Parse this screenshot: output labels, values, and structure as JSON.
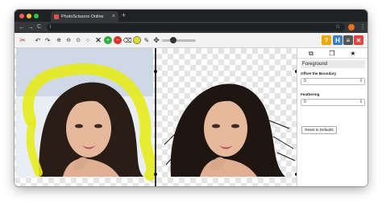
{
  "browser": {
    "tab_title": "PhotoScissors Online",
    "tab_close": "×",
    "new_tab": "+",
    "nav_back": "←",
    "nav_forward": "→",
    "nav_reload": "C",
    "info_icon": "i",
    "star": "☆",
    "menu": "⋮",
    "traffic_colors": [
      "#ff5f57",
      "#febc2e",
      "#28c840"
    ],
    "profile_color": "#e8711a"
  },
  "toolbar": {
    "icons": [
      "app-logo",
      "undo",
      "redo",
      "zoom-in",
      "zoom-out",
      "zoom-fit",
      "zoom-reset",
      "clear-marks",
      "foreground-marker",
      "background-marker",
      "eraser",
      "auto-contour",
      "eraser-alt",
      "pan"
    ],
    "right_buttons": [
      {
        "label": "?",
        "color": "#f0a500"
      },
      {
        "label": "H",
        "color": "#3b7fc4"
      },
      {
        "label": "≡",
        "color": "#555555"
      },
      {
        "label": "✕",
        "color": "#e8423c"
      }
    ]
  },
  "panel": {
    "title": "Foreground",
    "offset_label": "Offset the Boundary",
    "offset_value": "0",
    "feathering_label": "Feathering",
    "feathering_value": "0",
    "reset_label": "Reset to Defaults"
  }
}
